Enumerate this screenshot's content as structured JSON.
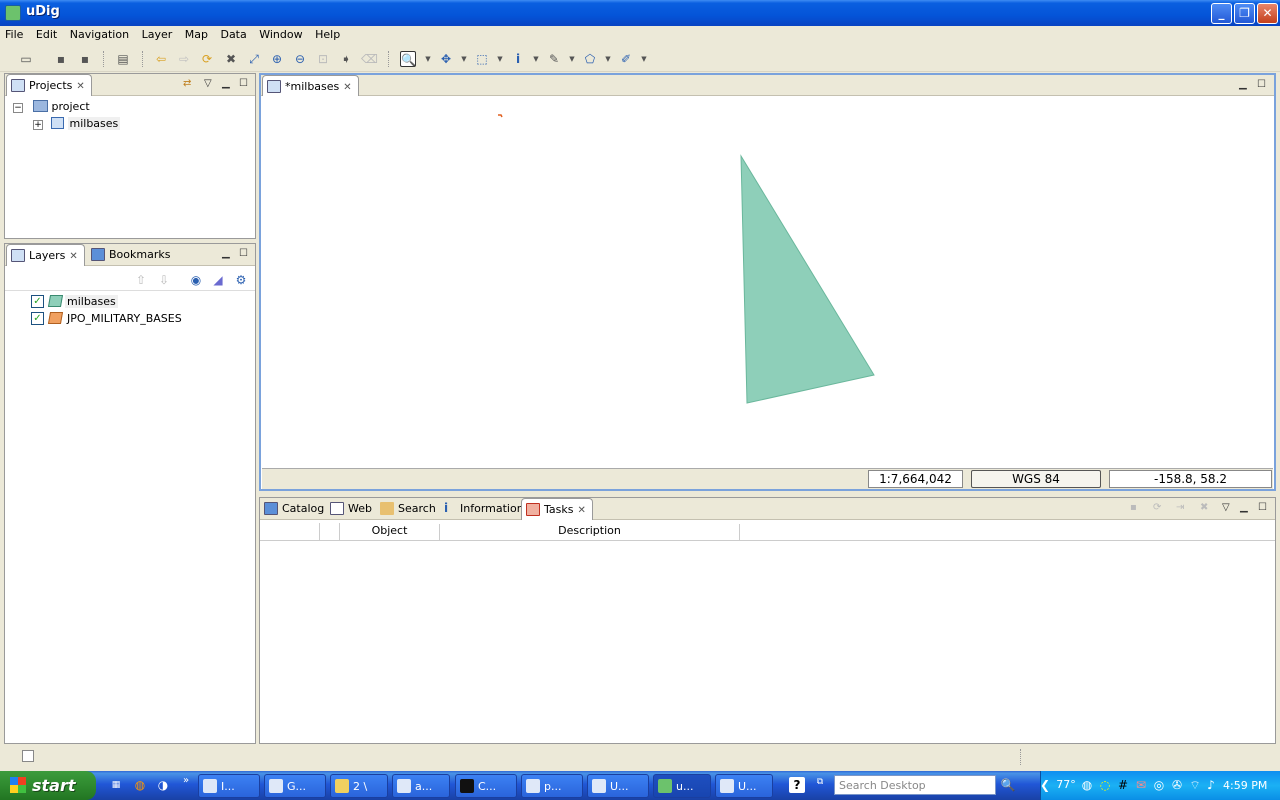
{
  "window": {
    "title": "uDig"
  },
  "menu": [
    "File",
    "Edit",
    "Navigation",
    "Layer",
    "Map",
    "Data",
    "Window",
    "Help"
  ],
  "projects_panel": {
    "tab": "Projects",
    "tree": {
      "root": "project",
      "child": "milbases"
    }
  },
  "layers_panel": {
    "tabs": [
      "Layers",
      "Bookmarks"
    ],
    "layers": [
      {
        "name": "milbases",
        "checked": true,
        "color": "#8ecfb9"
      },
      {
        "name": "JPO_MILITARY_BASES",
        "checked": true,
        "color": "#f0a060"
      }
    ]
  },
  "map_editor": {
    "tab": "*milbases",
    "scale": "1:7,664,042",
    "crs": "WGS 84",
    "coords": "-158.8, 58.2",
    "polygon_color": "#8ecfb9"
  },
  "bottom_panel": {
    "tabs": [
      "Catalog",
      "Web",
      "Search",
      "Information",
      "Tasks"
    ],
    "active_tab": "Tasks",
    "columns": [
      "",
      "",
      "Object",
      "Description"
    ]
  },
  "taskbar": {
    "start": "start",
    "tasks": [
      "I...",
      "G...",
      "2 \\",
      "a...",
      "C...",
      "p...",
      "U...",
      "u...",
      "U..."
    ],
    "search_placeholder": "Search Desktop",
    "clock": "4:59 PM",
    "temp": "77°"
  }
}
